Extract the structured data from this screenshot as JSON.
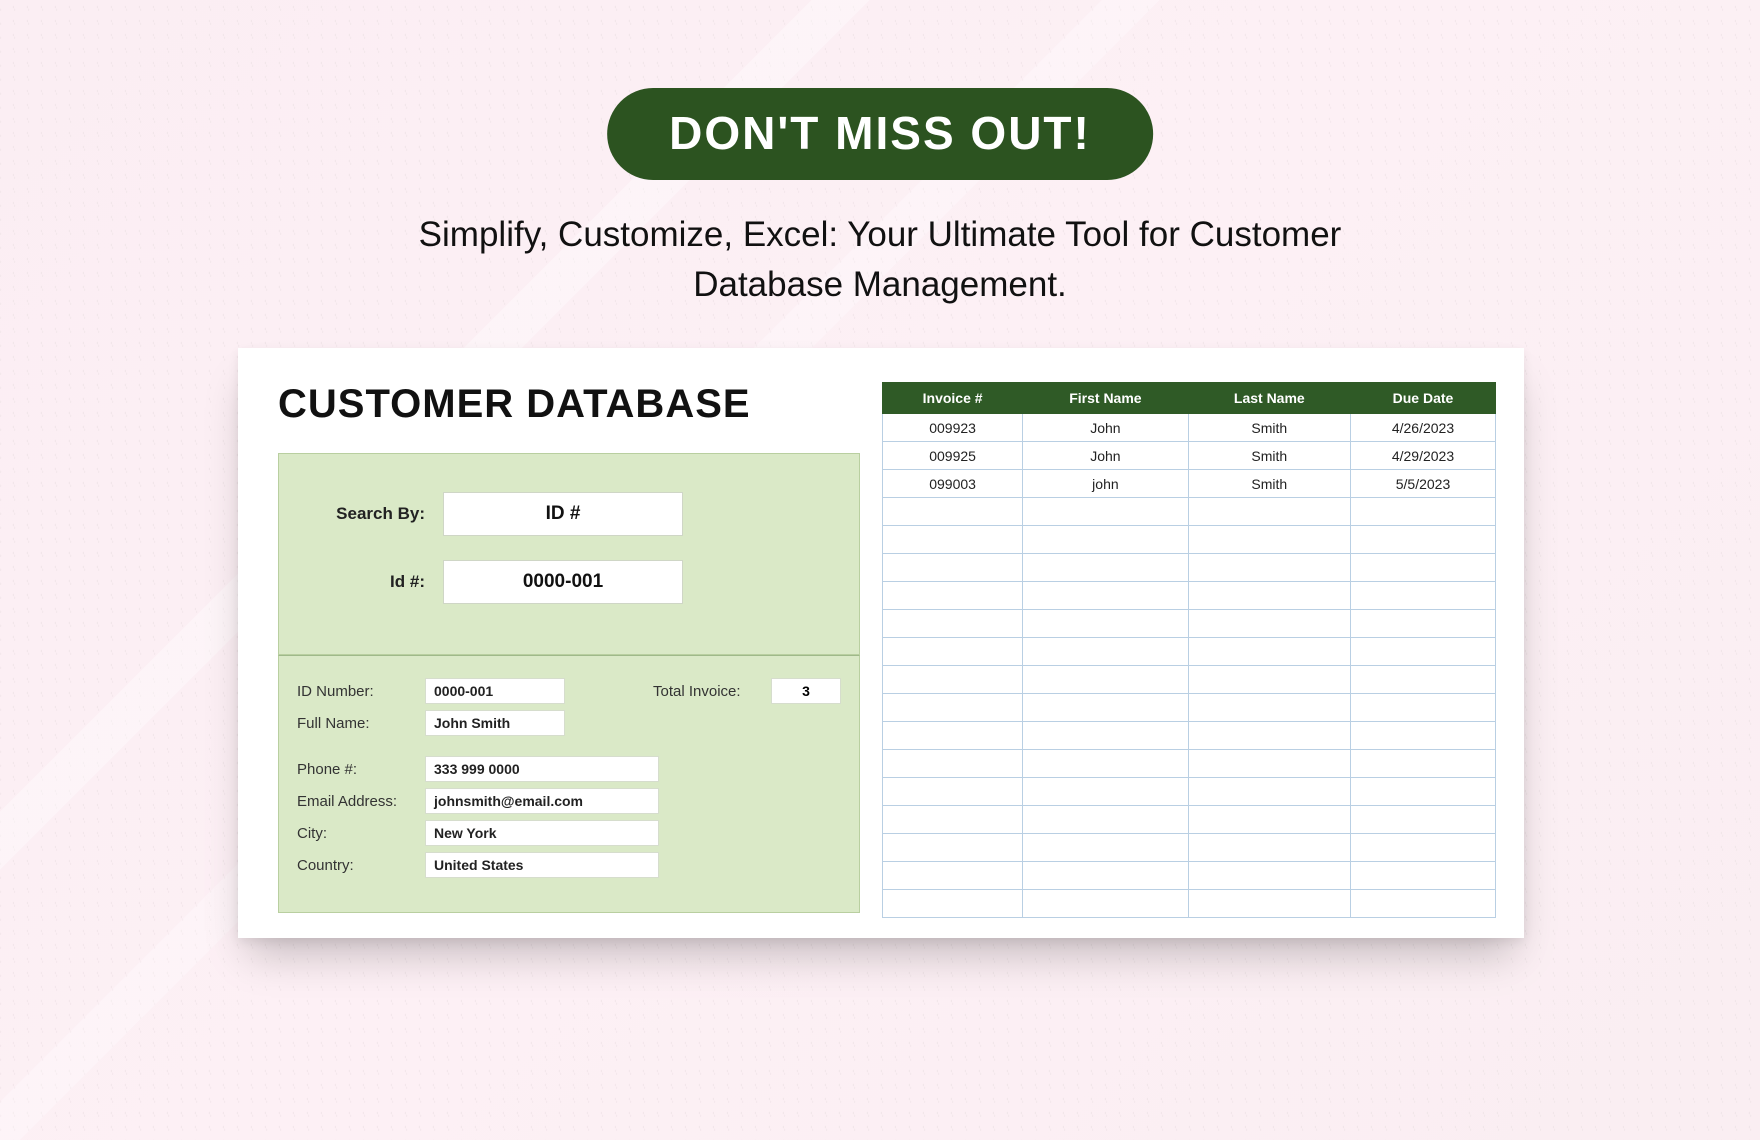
{
  "promo": {
    "pill": "DON'T MISS OUT!",
    "tagline": "Simplify, Customize, Excel: Your Ultimate Tool for Customer Database Management."
  },
  "db": {
    "title": "CUSTOMER DATABASE",
    "search": {
      "by_label": "Search By:",
      "by_value": "ID #",
      "id_label": "Id #:",
      "id_value": "0000-001"
    },
    "details": {
      "id_number_label": "ID Number:",
      "id_number": "0000-001",
      "total_invoice_label": "Total Invoice:",
      "total_invoice": "3",
      "full_name_label": "Full Name:",
      "full_name": "John Smith",
      "phone_label": "Phone #:",
      "phone": "333 999 0000",
      "email_label": "Email Address:",
      "email": "johnsmith@email.com",
      "city_label": "City:",
      "city": "New York",
      "country_label": "Country:",
      "country": "United States"
    }
  },
  "table": {
    "headers": [
      "Invoice #",
      "First Name",
      "Last Name",
      "Due Date"
    ],
    "rows": [
      [
        "009923",
        "John",
        "Smith",
        "4/26/2023"
      ],
      [
        "009925",
        "John",
        "Smith",
        "4/29/2023"
      ],
      [
        "099003",
        "john",
        "Smith",
        "5/5/2023"
      ]
    ],
    "empty_rows": 15
  }
}
